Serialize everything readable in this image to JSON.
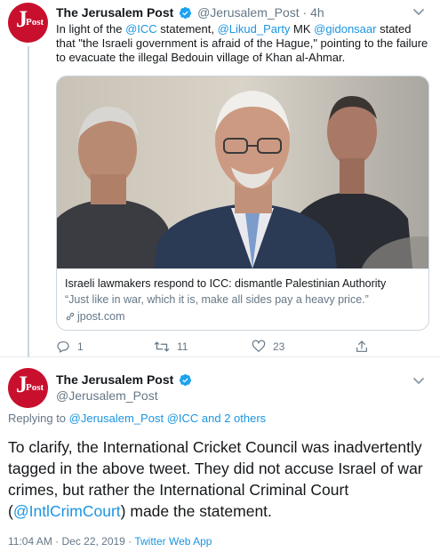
{
  "tweet1": {
    "author_name": "The Jerusalem Post",
    "author_handle": "@Jerusalem_Post",
    "separator": " · ",
    "time": "4h",
    "avatar": {
      "letter": "J",
      "word": "Post",
      "color": "#c8102e"
    },
    "text": {
      "p1": "In light of the ",
      "mention_icc": "@ICC",
      "p2": " statement, ",
      "mention_likud": "@Likud_Party",
      "p3": " MK ",
      "mention_gidon": "@gidonsaar",
      "p4": " stated that \"the Israeli government is afraid of the Hague,\" pointing to the failure to evacuate the illegal Bedouin village of Khan al-Ahmar."
    },
    "card": {
      "title": "Israeli lawmakers respond to ICC: dismantle Palestinian Authority",
      "description": "“Just like in war, which it is, make all sides pay a heavy price.”",
      "domain": "jpost.com"
    },
    "actions": {
      "reply_count": "1",
      "retweet_count": "11",
      "like_count": "23"
    }
  },
  "tweet2": {
    "author_name": "The Jerusalem Post",
    "author_handle": "@Jerusalem_Post",
    "replying": {
      "prefix": "Replying to ",
      "mention1": "@Jerusalem_Post",
      "space1": " ",
      "mention2": "@ICC",
      "rest": " and 2 others"
    },
    "text": {
      "p1": "To clarify, the International Cricket Council was inadvertently tagged in the above tweet. They did not accuse Israel of war crimes, but rather the International Criminal Court (",
      "mention": "@IntlCrimCourt",
      "p2": ") made the statement."
    },
    "meta": {
      "timestamp": "11:04 AM · Dec 22, 2019",
      "separator": " · ",
      "source": "Twitter Web App"
    }
  },
  "colors": {
    "link": "#1b95e0",
    "muted": "#657786",
    "brand_red": "#c8102e",
    "verified": "#1da1f2"
  },
  "icons": {
    "verified": "verified-badge-icon",
    "caret": "chevron-down-icon",
    "reply": "reply-icon",
    "retweet": "retweet-icon",
    "like": "heart-icon",
    "share": "share-icon",
    "link": "link-icon"
  }
}
